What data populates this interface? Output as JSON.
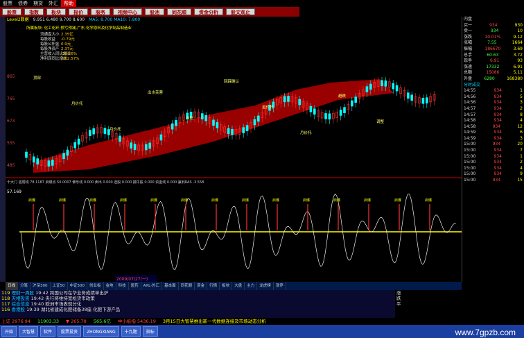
{
  "menu": [
    "股票",
    "债券",
    "期货",
    "外汇",
    "帮助"
  ],
  "buttons": [
    "股票",
    "指数",
    "板块",
    "报价",
    "服务",
    "视频中心",
    "股池",
    "同花顺",
    "资金分析",
    "股文观止"
  ],
  "info": {
    "title": "Level2数据",
    "items": [
      "技术分析",
      "F10资料",
      "主力动向",
      "选股",
      "指标",
      "周期",
      "画线"
    ],
    "price_line": "9.951  6.480  9.700  8.600",
    "ma": "MA5: 8.700  MA10: 7.800"
  },
  "stock_info": {
    "header": "所属板块: 化工化纤,预亏预减,广东,化学原料及化学制品制造业",
    "rows": [
      [
        "流通盘大小",
        "2.35亿"
      ],
      [
        "每股收益",
        "-0.79元"
      ],
      [
        "每股公积金",
        "0.9元"
      ],
      [
        "每股净资产",
        "2.37元"
      ],
      [
        "主营收入同比增长",
        "-30.26%"
      ],
      [
        "净利润同比增长",
        "-962.57%"
      ]
    ]
  },
  "y_ticks": [
    "865",
    "765",
    "673",
    "555",
    "485"
  ],
  "price_labels": [
    "顶部",
    "月价托",
    "月价托",
    "出水芙蓉",
    "启航",
    "回踩确认",
    "金价托",
    "月价托",
    "超跌",
    "调整"
  ],
  "lower_header": "十大门  强弱线  78.1187  启爆点  50.0007  佛乐线  0.000  卖出  0.000  选股  0.000  捕牛股  0.000  资金线  0.000  赢利RAS  -3.558",
  "lower_val": "57.169",
  "date_label": "2009/07/27(一)",
  "tabs": [
    "日线",
    "分笔",
    "沪深300",
    "上证50",
    "中证500",
    "创业板",
    "金地",
    "科技",
    "医药",
    "AXL-外汇",
    "基本面",
    "同花顺",
    "资金",
    "行情",
    "板块",
    "大盘",
    "主力",
    "龙虎榜",
    "涨停"
  ],
  "quote": {
    "title": "内盘",
    "rows": [
      [
        "买一",
        "934",
        "930"
      ],
      [
        "卖一",
        "934",
        "10"
      ],
      [
        "涨跌",
        "10.01%",
        "9.12"
      ],
      [
        "涨幅",
        "7.55",
        "1664"
      ],
      [
        "振幅",
        "186670",
        "3.69"
      ],
      [
        "总手",
        "60.63",
        "3.72"
      ],
      [
        "现手",
        "6.91",
        "93"
      ],
      [
        "涨速",
        "17332",
        "6.91"
      ],
      [
        "总额",
        "15086",
        "5.11"
      ],
      [
        "外盘",
        "6280",
        "168380"
      ]
    ],
    "section": "分时成交",
    "ticks": [
      [
        "14:55",
        "934",
        "1"
      ],
      [
        "14:56",
        "934",
        "5"
      ],
      [
        "14:56",
        "934",
        "3"
      ],
      [
        "14:57",
        "934",
        "2"
      ],
      [
        "14:57",
        "934",
        "8"
      ],
      [
        "14:58",
        "934",
        "4"
      ],
      [
        "14:58",
        "934",
        "12"
      ],
      [
        "14:59",
        "934",
        "6"
      ],
      [
        "14:59",
        "934",
        "3"
      ],
      [
        "15:00",
        "934",
        "20"
      ],
      [
        "15:00",
        "934",
        "7"
      ],
      [
        "15:00",
        "934",
        "1"
      ],
      [
        "15:00",
        "934",
        "2"
      ],
      [
        "15:00",
        "934",
        "4"
      ],
      [
        "15:00",
        "934",
        "9"
      ],
      [
        "15:00",
        "934",
        "15"
      ]
    ]
  },
  "news": [
    [
      "119",
      "理财一周股",
      "19:42 跨国公司在华业务成绩单出炉"
    ],
    [
      "118",
      "天相投资",
      "19:42 央行将维持宽松货币政策"
    ],
    [
      "117",
      "综合信息",
      "19:40 欧洲市场表现分化"
    ],
    [
      "116",
      "香港股",
      "19:39 湖北省建成化肥储备38座 化肥下游产品"
    ]
  ],
  "news_right": [
    "涨",
    "跌",
    "平"
  ],
  "ticker": [
    [
      "上证",
      "2976.94"
    ],
    [
      "",
      "11903.33"
    ],
    [
      "▼",
      "265.78"
    ],
    [
      "",
      "565.6亿"
    ],
    [
      "中小板指",
      "5436.19"
    ]
  ],
  "subtitle": "3月15日大智慧推出新一代数据连接及市场动态分析",
  "taskbar": [
    "开始",
    "大智慧",
    "软件",
    "股票投资",
    "ZHONGXIANG",
    "十九题",
    "指标"
  ],
  "watermark": "www.7gpzb.com",
  "colors": {
    "up": "#ff3333",
    "down": "#33ff33",
    "band": "#990000",
    "accent": "#ffff00"
  }
}
